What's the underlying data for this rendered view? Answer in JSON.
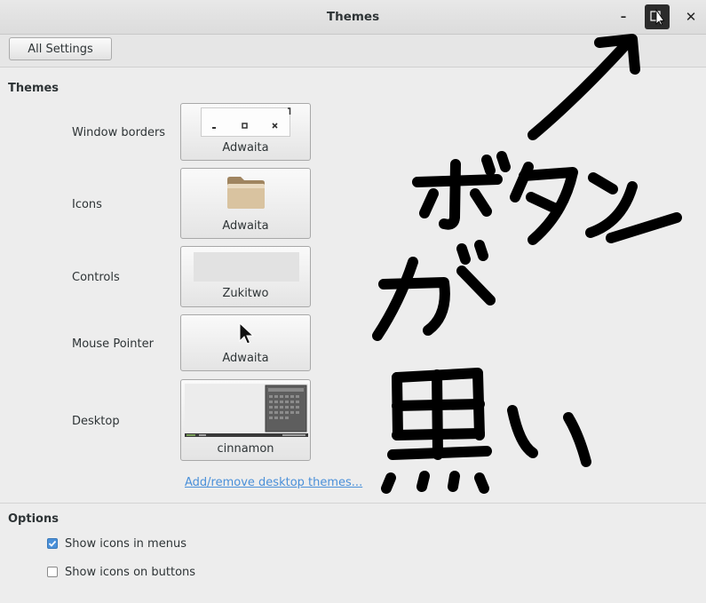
{
  "window": {
    "title": "Themes",
    "min_glyph": "–",
    "max_glyph": "□",
    "close_glyph": "✕"
  },
  "toolbar": {
    "all_settings_label": "All Settings"
  },
  "themes_section": {
    "heading": "Themes",
    "rows": [
      {
        "label": "Window borders",
        "value": "Adwaita",
        "icon": "window-borders-preview-icon"
      },
      {
        "label": "Icons",
        "value": "Adwaita",
        "icon": "folder-icon"
      },
      {
        "label": "Controls",
        "value": "Zukitwo",
        "icon": "controls-preview"
      },
      {
        "label": "Mouse Pointer",
        "value": "Adwaita",
        "icon": "pointer-icon"
      },
      {
        "label": "Desktop",
        "value": "cinnamon",
        "icon": "desktop-preview"
      }
    ],
    "link": "Add/remove desktop themes..."
  },
  "options_section": {
    "heading": "Options",
    "items": [
      {
        "label": "Show icons in menus",
        "checked": true
      },
      {
        "label": "Show icons on buttons",
        "checked": false
      }
    ]
  },
  "annotation": {
    "handwriting": "ボタンが黒い"
  },
  "colors": {
    "link": "#4a90d9",
    "checkbox_on": "#4a90d9",
    "max_button_bg": "#2b2b2b"
  }
}
